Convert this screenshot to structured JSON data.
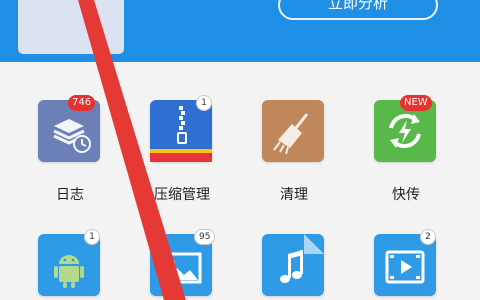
{
  "header": {
    "button_label": "立即分析",
    "color": "#1e8fe4"
  },
  "apps": [
    {
      "label": "日志",
      "badge": "746",
      "badge_style": "red",
      "icon": "log-stack-icon",
      "color": "#6b80b7"
    },
    {
      "label": "压缩管理",
      "badge": "1",
      "badge_style": "white",
      "icon": "zip-archive-icon",
      "color": "#2f6fd1"
    },
    {
      "label": "清理",
      "badge": "",
      "badge_style": "",
      "icon": "broom-icon",
      "color": "#c0875a"
    },
    {
      "label": "快传",
      "badge": "NEW",
      "badge_style": "red",
      "icon": "sync-bolt-icon",
      "color": "#58b84a"
    },
    {
      "label": "",
      "badge": "1",
      "badge_style": "white",
      "icon": "android-icon",
      "color": "#2f9be6"
    },
    {
      "label": "",
      "badge": "95",
      "badge_style": "white",
      "icon": "picture-icon",
      "color": "#2f9be6"
    },
    {
      "label": "",
      "badge": "",
      "badge_style": "",
      "icon": "music-note-icon",
      "color": "#2f9be6"
    },
    {
      "label": "",
      "badge": "2",
      "badge_style": "white",
      "icon": "video-play-icon",
      "color": "#2f9be6"
    }
  ],
  "annotation_color": "#e53935"
}
